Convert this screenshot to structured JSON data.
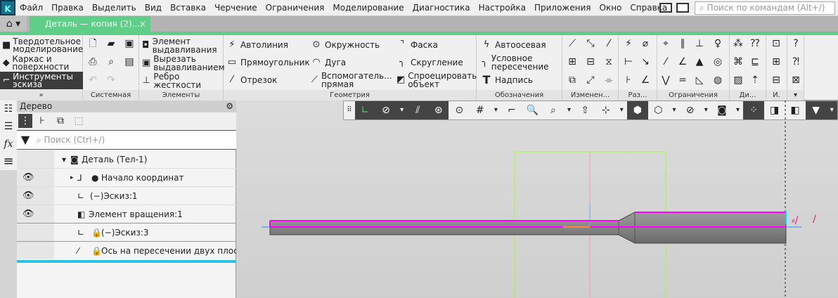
{
  "menubar": {
    "items": [
      "Файл",
      "Правка",
      "Выделить",
      "Вид",
      "Вставка",
      "Черчение",
      "Ограничения",
      "Моделирование",
      "Диагностика",
      "Настройка",
      "Приложения",
      "Окно",
      "Справка"
    ],
    "search_placeholder": "Поиск по командам (Alt+/)"
  },
  "tabs": {
    "document": "Деталь — копия (2)....",
    "close": "×"
  },
  "ribbon": {
    "modes": [
      "Твердотельное моделирование",
      "Каркас и поверхности",
      "Инструменты эскиза"
    ],
    "groups": {
      "system": "Системная",
      "elements": "Элементы",
      "geometry": "Геометрия",
      "notation": "Обозначения",
      "edit": "Изменен...",
      "dims": "Раз...",
      "constraints": "Ограничения",
      "diag": "Ди...",
      "i": "И."
    },
    "elements": [
      "Элемент выдавливания",
      "Вырезать выдавливанием",
      "Ребро жесткости"
    ],
    "geometry": [
      "Автолиния",
      "Прямоугольник",
      "Отрезок",
      "Окружность",
      "Дуга",
      "Вспомогатель... прямая",
      "Фаска",
      "Скругление",
      "Спроецировать объект"
    ],
    "notation": [
      "Автоосевая",
      "Условное пересечение",
      "Надпись"
    ]
  },
  "tree": {
    "title": "Дерево",
    "search_placeholder": "Поиск (Ctrl+/)",
    "rows": [
      {
        "label": "Деталь (Тел-1)",
        "visible": false
      },
      {
        "label": "Начало координат",
        "visible": true
      },
      {
        "label": "(−)Эскиз:1",
        "visible": true
      },
      {
        "label": "Элемент вращения:1",
        "visible": true
      },
      {
        "label": "(−)Эскиз:3",
        "visible": false
      },
      {
        "label": "Ось на пересечении двух плоскост",
        "visible": false
      }
    ]
  },
  "colors": {
    "accent": "#5fcf88",
    "sketch": "#ff00ff",
    "axis": "#1e90ff",
    "bbox": "#99ff33"
  }
}
